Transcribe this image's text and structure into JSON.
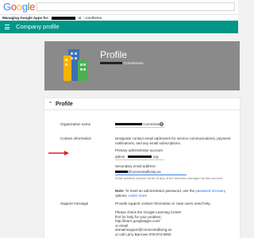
{
  "header": {
    "logo": "Google",
    "logo_colors": [
      "#4285f4",
      "#ea4335",
      "#fbbc05",
      "#4285f4",
      "#34a853",
      "#ea4335"
    ],
    "managing_prefix": "Managing Google Apps for:",
    "managing_suffix": "Company Profile",
    "subbar_extra": "at   ::  comtheme"
  },
  "appbar": {
    "title": "Company profile",
    "color": "#009688"
  },
  "banner": {
    "title": "Profile",
    "subtitle": "Commission"
  },
  "card": {
    "section_title": "Profile",
    "org_name_label": "Organization name",
    "org_name_value": "Commission",
    "contact_label": "Contact information",
    "contact_desc": "Designate contact email addresses for service communications, payment notifications, and any email subscriptions.",
    "primary_admin_label": "Primary administrator account",
    "primary_admin_value": "admin",
    "primary_admin_domain": ".org",
    "secondary_label": "Secondary email address",
    "secondary_value": "@connectedliving.us",
    "secondary_hint": "Email address should not be of any of the domains managed by this account",
    "note_prefix": "Note:",
    "note_text": "To reset an administrator password, use the",
    "note_link": "password recovery",
    "note_suffix": "options.",
    "learn_more": "Learn more",
    "support_label": "Support message",
    "support_desc": "Provide support contact information in case users need help.",
    "support_lines": [
      "Please check the Google Learning Center",
      "first for help for your problem:",
      "http://learn.googleapps.com/",
      "or email",
      "domainsupport@connectedliving.us",
      "or call Larry Barrows 978-973-9000"
    ]
  }
}
